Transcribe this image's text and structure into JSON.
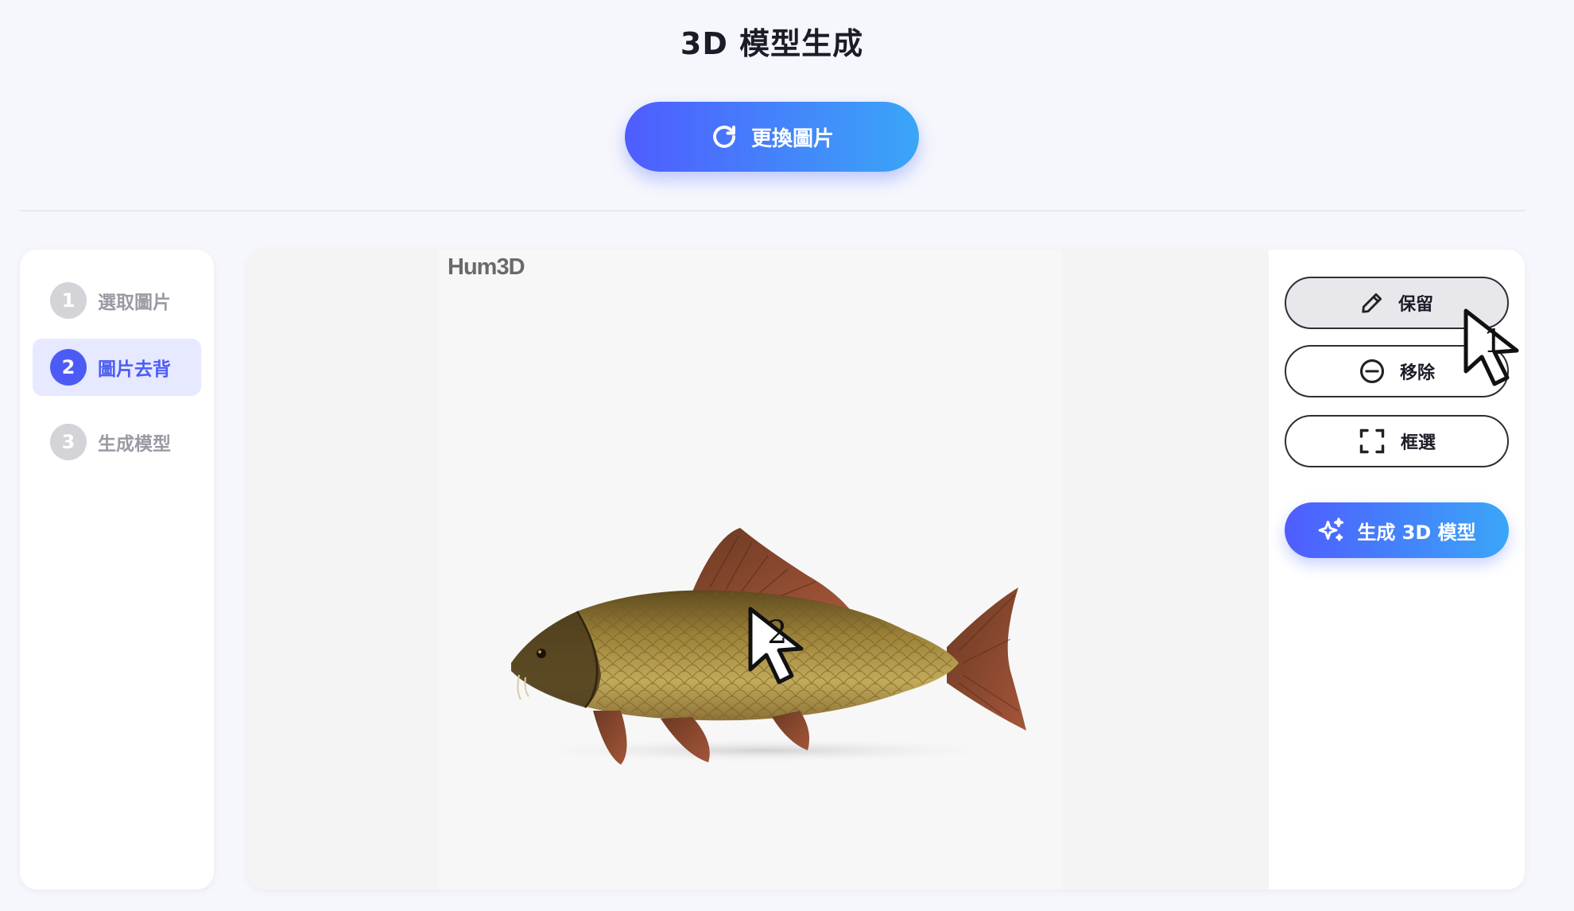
{
  "page": {
    "title": "3D 模型生成"
  },
  "header": {
    "change_image_label": "更換圖片"
  },
  "steps": [
    {
      "number": "1",
      "label": "選取圖片",
      "active": false
    },
    {
      "number": "2",
      "label": "圖片去背",
      "active": true
    },
    {
      "number": "3",
      "label": "生成模型",
      "active": false
    }
  ],
  "preview": {
    "watermark": "Hum3D",
    "subject": "carp fish"
  },
  "tools": {
    "keep_label": "保留",
    "remove_label": "移除",
    "select_label": "框選",
    "generate_label": "生成 3D 模型"
  },
  "annotations": {
    "cursor1": "1",
    "cursor2": "2"
  },
  "colors": {
    "accent": "#4d5bf5",
    "accent_light": "#e6e9ff",
    "gradient_start": "#4f5cff",
    "gradient_end": "#3aa6f7"
  },
  "icons": [
    "refresh-icon",
    "pencil-icon",
    "minus-circle-icon",
    "frame-select-icon",
    "sparkle-icon"
  ]
}
